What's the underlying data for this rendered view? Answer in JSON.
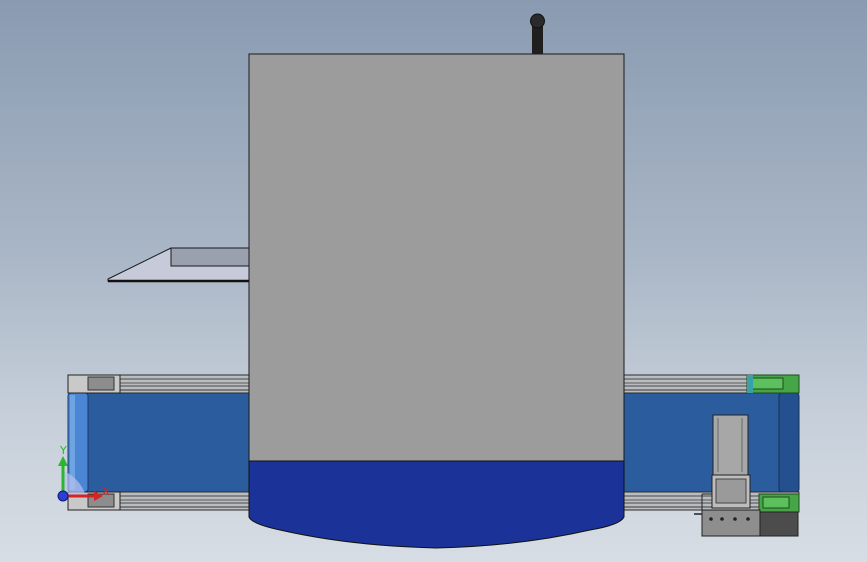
{
  "viewport": {
    "background_top": "#8a9bb1",
    "background_bottom": "#d7dde4"
  },
  "colors": {
    "hopper_body": "#9c9c9c",
    "hopper_base": "#1b3399",
    "belt": "#2b5c9e",
    "belt_roller": "#4a86d4",
    "rail": "#b9bcc0",
    "bracket_green": "#46a546",
    "motor": "#a7a7a7",
    "chute": "#c6cad9",
    "edge": "#1a1a1a"
  },
  "triad": {
    "y_label": "Y",
    "x_label": "X",
    "y_color": "#2db52d",
    "x_color": "#d42424",
    "z_color": "#2b3fd4"
  }
}
